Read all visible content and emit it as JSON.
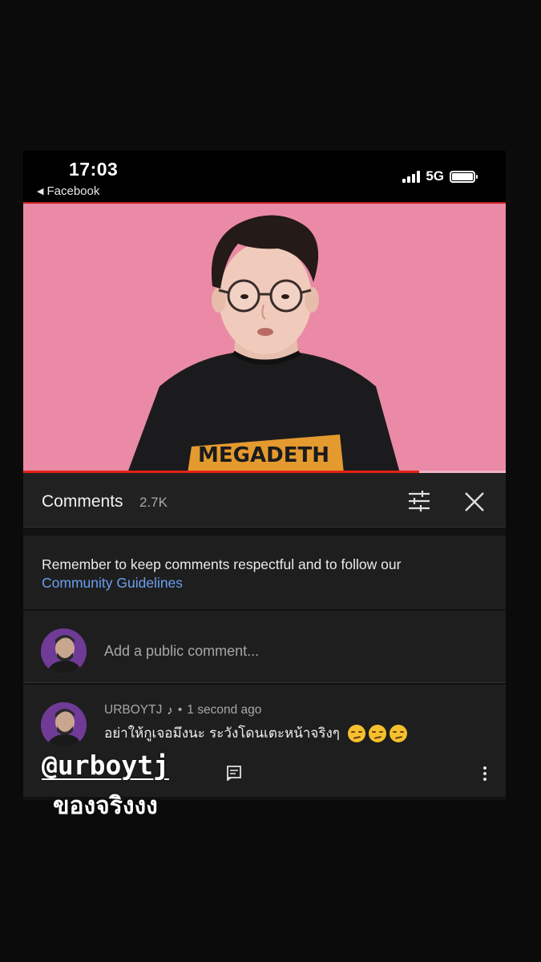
{
  "status_bar": {
    "time": "17:03",
    "back_app": "Facebook",
    "network": "5G",
    "signal_bars": 4,
    "battery_level": 1.0
  },
  "video": {
    "background_color": "#ea8aa6",
    "progress": 0.82,
    "shirt_logo": "MEGADETH"
  },
  "comments_header": {
    "title": "Comments",
    "count": "2.7K",
    "sort_icon": "sort-sliders-icon",
    "close_icon": "close-icon"
  },
  "guidelines": {
    "text": "Remember to keep comments respectful and to follow our",
    "link": "Community Guidelines",
    "link_color": "#6a9ff0"
  },
  "add_comment": {
    "placeholder": "Add a public comment..."
  },
  "comment": {
    "author": "URBOYTJ",
    "separator": "•",
    "time": "1 second ago",
    "text": "อย่าให้กูเจอมึงนะ ระวังโดนเตะหน้าจริงๆ",
    "emoji_count": 3,
    "emoji_name": "smirking-face"
  },
  "overlay": {
    "handle": "@urboytj",
    "caption": "ของจริงงง"
  }
}
